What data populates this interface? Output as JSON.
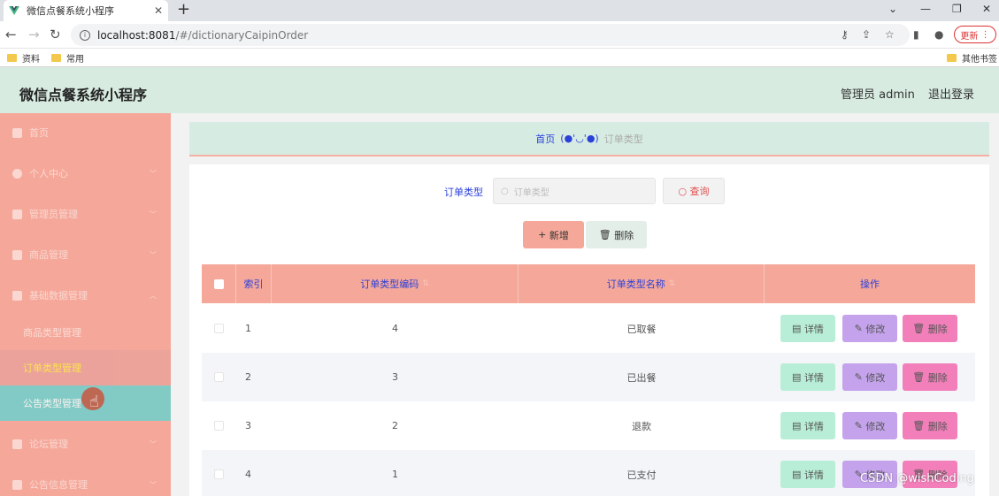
{
  "browser": {
    "tab_title": "微信点餐系统小程序",
    "tab_close": "✕",
    "new_tab": "+",
    "url_host": "localhost:8081",
    "url_path": "/#/dictionaryCaipinOrder",
    "update_label": "更新",
    "bookmarks": [
      "资料",
      "常用"
    ],
    "other_bookmarks": "其他书签"
  },
  "header": {
    "title": "微信点餐系统小程序",
    "admin": "管理员 admin",
    "logout": "退出登录"
  },
  "sidebar": {
    "items": [
      {
        "label": "首页"
      },
      {
        "label": "个人中心"
      },
      {
        "label": "管理员管理"
      },
      {
        "label": "商品管理"
      },
      {
        "label": "基础数据管理"
      },
      {
        "label": "论坛管理"
      },
      {
        "label": "公告信息管理"
      }
    ],
    "sub_items": [
      {
        "label": "商品类型管理"
      },
      {
        "label": "订单类型管理"
      },
      {
        "label": "公告类型管理"
      }
    ]
  },
  "breadcrumb": {
    "home": "首页",
    "face": "(●'◡'●)",
    "current": "订单类型"
  },
  "search": {
    "label": "订单类型",
    "placeholder": "订单类型",
    "query_button": "查询"
  },
  "actions": {
    "add": "新增",
    "delete": "删除"
  },
  "table": {
    "columns": [
      "索引",
      "订单类型编码",
      "订单类型名称",
      "操作"
    ],
    "rows": [
      {
        "index": "1",
        "code": "4",
        "name": "已取餐"
      },
      {
        "index": "2",
        "code": "3",
        "name": "已出餐"
      },
      {
        "index": "3",
        "code": "2",
        "name": "退款"
      },
      {
        "index": "4",
        "code": "1",
        "name": "已支付"
      }
    ],
    "row_actions": {
      "detail": "详情",
      "edit": "修改",
      "delete": "删除"
    }
  },
  "watermark": "CSDN @wishCoding",
  "colors": {
    "accent": "#f5a89a",
    "header_bg": "#d8ebe1",
    "link": "#2b3fd9",
    "detail": "#b8eed7",
    "edit": "#c4a3ec",
    "delete": "#f27fba"
  }
}
